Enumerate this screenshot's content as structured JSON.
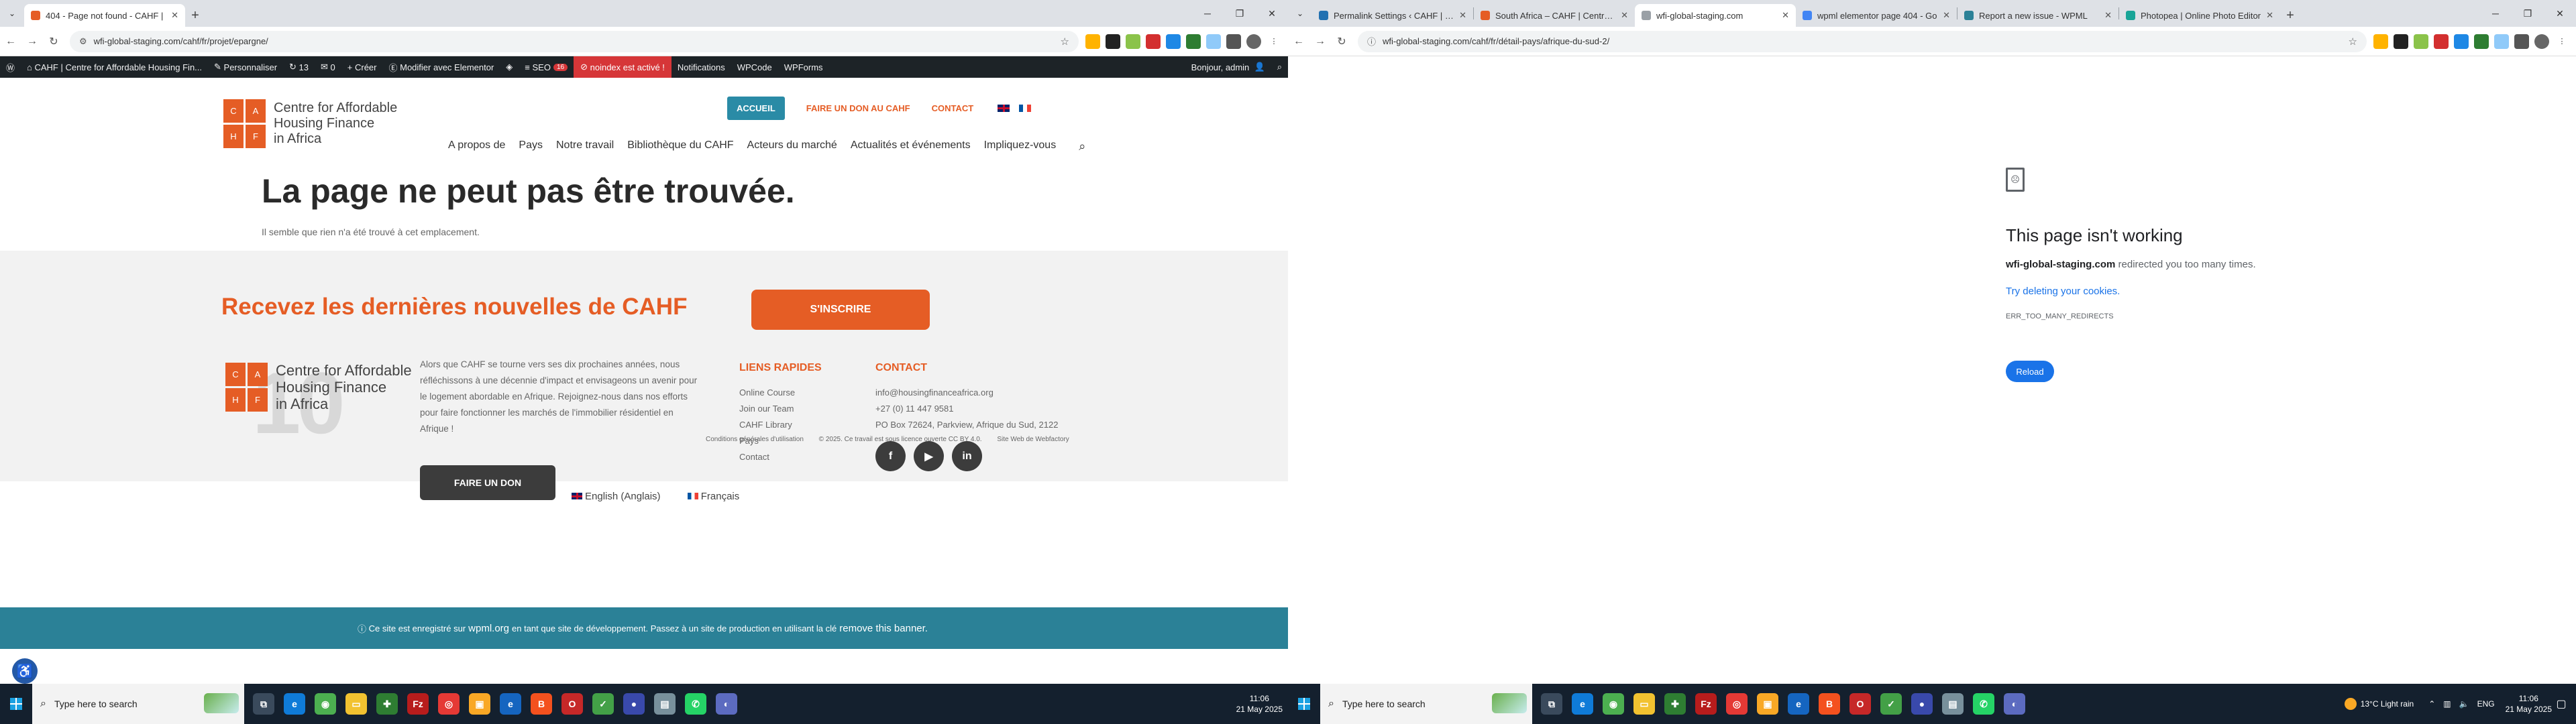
{
  "left": {
    "tabs": [
      {
        "title": "404 - Page not found - CAHF |",
        "color": "#e55d25",
        "active": true
      }
    ],
    "url": "wfi-global-staging.com/cahf/fr/projet/epargne/",
    "extension_colors": [
      "#ffb300",
      "#222222",
      "#8bc34a",
      "#d32f2f",
      "#1e88e5",
      "#2e7d32",
      "#90caf9",
      "#555555"
    ],
    "wpbar": {
      "site": "CAHF | Centre for Affordable Housing Fin...",
      "customize": "Personnaliser",
      "updates": "13",
      "comments": "0",
      "new": "Créer",
      "elementor": "Modifier avec Elementor",
      "seo": "SEO",
      "seo_badge": "16",
      "noindex": "noindex est activé !",
      "notifications": "Notifications",
      "wpcode": "WPCode",
      "wpforms": "WPForms",
      "greeting": "Bonjour, admin"
    },
    "site": {
      "logo": {
        "letters": [
          "C",
          "A",
          "H",
          "F"
        ],
        "line1": "Centre for Affordable",
        "line2": "Housing Finance",
        "line3": "in Africa"
      },
      "topnav": {
        "home": "ACCUEIL",
        "donate": "FAIRE UN DON AU CAHF",
        "contact": "CONTACT"
      },
      "mainnav": [
        "A propos de",
        "Pays",
        "Notre travail",
        "Bibliothèque du CAHF",
        "Acteurs du marché",
        "Actualités et événements",
        "Impliquez-vous"
      ],
      "heading": "La page ne peut pas être trouvée.",
      "subtext": "Il semble que rien n'a été trouvé à cet emplacement.",
      "footer": {
        "newsletter": "Recevez les dernières nouvelles de CAHF",
        "subscribe": "S'INSCRIRE",
        "big_number": "10",
        "about": "Alors que CAHF se tourne vers ses dix prochaines années, nous réfléchissons à une décennie d'impact et envisageons un avenir pour le logement abordable en Afrique. Rejoignez-nous dans nos efforts pour faire fonctionner les marchés de l'immobilier résidentiel en Afrique !",
        "donate_button": "FAIRE UN DON",
        "quick_links_title": "LIENS RAPIDES",
        "quick_links": [
          "Online Course",
          "Join our Team",
          "CAHF Library",
          "Pays",
          "Contact"
        ],
        "contact_title": "CONTACT",
        "contact_lines": [
          "info@housingfinanceafrica.org",
          "+27 (0) 11 447 9581",
          "PO Box 72624, Parkview, Afrique du Sud, 2122"
        ],
        "social": [
          "f",
          "▶",
          "in"
        ],
        "legal": [
          "Conditions générales d'utilisation",
          "© 2025. Ce travail est sous licence ouverte CC BY 4.0.",
          "Site Web de Webfactory"
        ]
      },
      "languages": [
        "English (Anglais)",
        "Français"
      ],
      "wpml_prefix": "Ce site est enregistré sur",
      "wpml_site": "wpml.org",
      "wpml_middle": "en tant que site de développement. Passez à un site de production en utilisant la clé",
      "wpml_remove": "remove this banner."
    },
    "clock": {
      "time": "11:06",
      "date": "21 May 2025"
    }
  },
  "right": {
    "tabs": [
      {
        "title": "Permalink Settings ‹ CAHF | Ce",
        "color": "#2271b1",
        "active": false
      },
      {
        "title": "South Africa – CAHF | Centre fo",
        "color": "#e55d25",
        "active": false
      },
      {
        "title": "wfi-global-staging.com",
        "color": "#9aa0a6",
        "active": true
      },
      {
        "title": "wpml elementor page 404 - Go",
        "color": "#4285f4",
        "active": false
      },
      {
        "title": "Report a new issue - WPML",
        "color": "#2b8197",
        "active": false
      },
      {
        "title": "Photopea | Online Photo Editor",
        "color": "#18a497",
        "active": false
      }
    ],
    "url": "wfi-global-staging.com/cahf/fr/détail-pays/afrique-du-sud-2/",
    "extension_colors": [
      "#ffb300",
      "#222222",
      "#8bc34a",
      "#d32f2f",
      "#1e88e5",
      "#2e7d32",
      "#90caf9",
      "#555555"
    ],
    "error": {
      "title": "This page isn't working",
      "host": "wfi-global-staging.com",
      "message": "redirected you too many times.",
      "link": "Try deleting your cookies.",
      "code": "ERR_TOO_MANY_REDIRECTS",
      "reload": "Reload"
    },
    "weather": {
      "temp": "13°C",
      "condition": "Light rain"
    },
    "lang": "ENG",
    "clock": {
      "time": "11:06",
      "date": "21 May 2025"
    }
  },
  "taskbar": {
    "search_placeholder": "Type here to search",
    "apps": [
      {
        "name": "task-view",
        "color": "#3a4a5c",
        "glyph": "⧉"
      },
      {
        "name": "edge",
        "color": "#0f7bd8",
        "glyph": "e"
      },
      {
        "name": "chrome",
        "color": "#4caf50",
        "glyph": "◉"
      },
      {
        "name": "files",
        "color": "#f2c230",
        "glyph": "▭"
      },
      {
        "name": "app-green",
        "color": "#2e7d32",
        "glyph": "✚"
      },
      {
        "name": "filezilla",
        "color": "#b71c1c",
        "glyph": "Fz"
      },
      {
        "name": "app-red",
        "color": "#e53935",
        "glyph": "◎"
      },
      {
        "name": "app-yellow",
        "color": "#f9a825",
        "glyph": "▣"
      },
      {
        "name": "edge-beta",
        "color": "#1565c0",
        "glyph": "e"
      },
      {
        "name": "brave",
        "color": "#f4511e",
        "glyph": "B"
      },
      {
        "name": "opera",
        "color": "#c62828",
        "glyph": "O"
      },
      {
        "name": "app-green2",
        "color": "#43a047",
        "glyph": "✓"
      },
      {
        "name": "app-blue",
        "color": "#3949ab",
        "glyph": "●"
      },
      {
        "name": "app-gray",
        "color": "#78909c",
        "glyph": "▤"
      },
      {
        "name": "whatsapp",
        "color": "#25d366",
        "glyph": "✆"
      },
      {
        "name": "app-purple",
        "color": "#5c6bc0",
        "glyph": "◐"
      }
    ]
  }
}
